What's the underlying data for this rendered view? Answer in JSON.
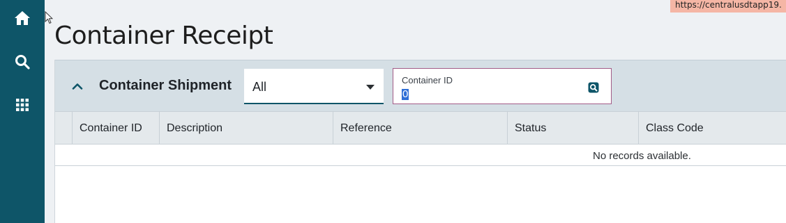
{
  "browser": {
    "url_tooltip": "https://centralusdtapp19."
  },
  "nav": [
    {
      "icon": "home-icon"
    },
    {
      "icon": "search-icon"
    },
    {
      "icon": "apps-grid-icon"
    }
  ],
  "page": {
    "title": "Container Receipt"
  },
  "panel": {
    "title": "Container Shipment",
    "collapse_icon": "chevron-up-icon",
    "filter": {
      "selected": "All",
      "icon": "caret-down-icon"
    },
    "container_id_field": {
      "label": "Container ID",
      "value": "0",
      "icon": "search-icon"
    }
  },
  "grid": {
    "columns": [
      "",
      "Container ID",
      "Description",
      "Reference",
      "Status",
      "Class Code"
    ],
    "empty_message": "No records available."
  },
  "colors": {
    "sidebar": "#0e5568",
    "header_band": "#d5dfe5",
    "field_border": "#a25b86",
    "selection": "#2f6fd6"
  }
}
